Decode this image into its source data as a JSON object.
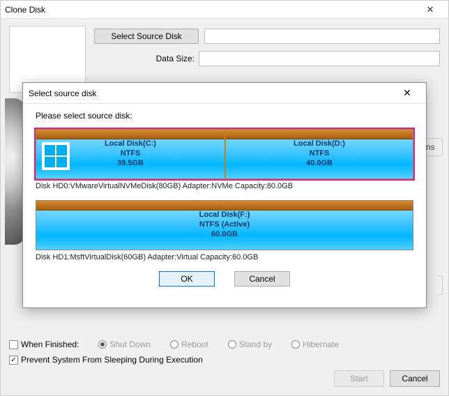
{
  "main": {
    "title": "Clone Disk",
    "select_source_btn": "Select Source Disk",
    "data_size_label": "Data Size:"
  },
  "finished": {
    "label": "When Finished:",
    "shut_down": "Shut Down",
    "reboot": "Reboot",
    "stand_by": "Stand by",
    "hibernate": "Hibernate",
    "prevent_sleep": "Prevent System From Sleeping During Execution"
  },
  "buttons": {
    "start": "Start",
    "cancel": "Cancel",
    "ok": "OK"
  },
  "cut_btn": "ns",
  "modal": {
    "title": "Select source disk",
    "prompt": "Please select source disk:",
    "disk0": {
      "partC": {
        "name": "Local Disk(C:)",
        "fs": "NTFS",
        "size": "39.5GB"
      },
      "partD": {
        "name": "Local Disk(D:)",
        "fs": "NTFS",
        "size": "40.0GB"
      },
      "info": "Disk HD0:VMwareVirtualNVMeDisk(80GB)  Adapter:NVMe  Capacity:80.0GB"
    },
    "disk1": {
      "partF": {
        "name": "Local Disk(F:)",
        "fs": "NTFS (Active)",
        "size": "60.0GB"
      },
      "info": "Disk HD1:MsftVirtualDisk(60GB)  Adapter:Virtual  Capacity:60.0GB"
    }
  }
}
